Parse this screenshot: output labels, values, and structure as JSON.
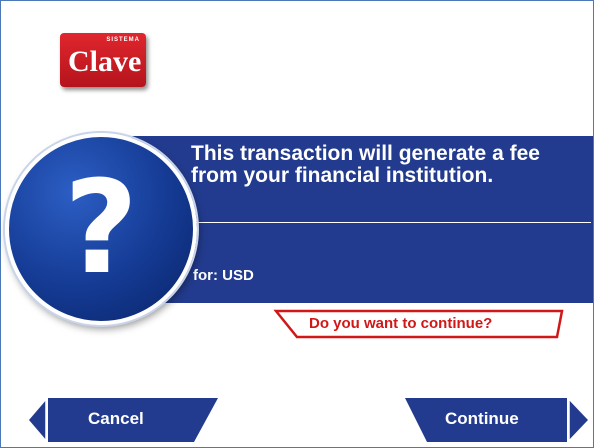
{
  "logo": {
    "top_text": "SISTEMA",
    "main_text": "Clave"
  },
  "dialog": {
    "message": "This transaction will generate a fee from your financial institution.",
    "fee_label": "for: USD",
    "prompt": "Do you want to continue?"
  },
  "buttons": {
    "cancel": "Cancel",
    "continue": "Continue"
  },
  "colors": {
    "panel": "#233b8e",
    "accent_red": "#d01818",
    "logo_red": "#d7212a",
    "border": "#4a78b8"
  },
  "icons": {
    "question": "question-mark-icon",
    "back": "chevron-left-icon",
    "forward": "chevron-right-icon"
  }
}
